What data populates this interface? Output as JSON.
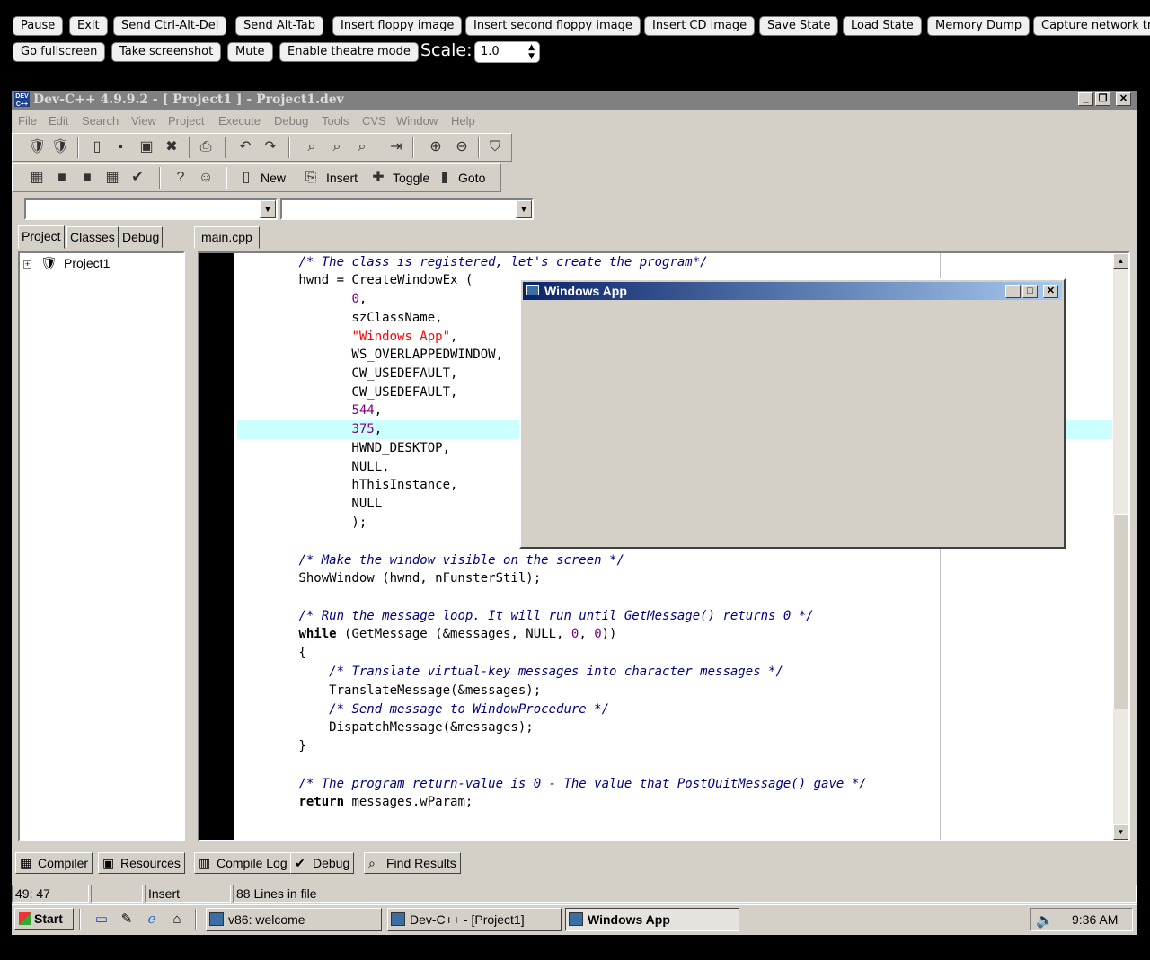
{
  "host_toolbar": {
    "buttons": [
      "Pause",
      "Exit",
      "Send Ctrl-Alt-Del",
      "Send Alt-Tab",
      "Insert floppy image",
      "Insert second floppy image",
      "Insert CD image",
      "Save State",
      "Load State",
      "Memory Dump",
      "Capture network traffic"
    ],
    "buttons_row2": [
      "Go fullscreen",
      "Take screenshot",
      "Mute",
      "Enable theatre mode"
    ],
    "scale_label": "Scale:",
    "scale_value": "1.0"
  },
  "ide": {
    "title": "Dev-C++ 4.9.9.2  -  [ Project1 ] - Project1.dev",
    "menu": [
      "File",
      "Edit",
      "Search",
      "View",
      "Project",
      "Execute",
      "Debug",
      "Tools",
      "CVS",
      "Window",
      "Help"
    ],
    "toolbar2": {
      "new_label": "New",
      "insert_label": "Insert",
      "toggle_label": "Toggle",
      "goto_label": "Goto"
    },
    "left_tabs": [
      "Project",
      "Classes",
      "Debug"
    ],
    "project_tree_root": "Project1",
    "file_tab": "main.cpp",
    "code_lines": [
      [
        {
          "t": "        "
        },
        {
          "t": "/* The class is registered, let's create the program*/",
          "c": "cm"
        }
      ],
      [
        {
          "t": "        hwnd = CreateWindowEx ("
        }
      ],
      [
        {
          "t": "               "
        },
        {
          "t": "0",
          "c": "nm"
        },
        {
          "t": ","
        }
      ],
      [
        {
          "t": "               szClassName,"
        }
      ],
      [
        {
          "t": "               "
        },
        {
          "t": "\"Windows App\"",
          "c": "st"
        },
        {
          "t": ","
        }
      ],
      [
        {
          "t": "               WS_OVERLAPPEDWINDOW,"
        }
      ],
      [
        {
          "t": "               CW_USEDEFAULT,"
        }
      ],
      [
        {
          "t": "               CW_USEDEFAULT,"
        }
      ],
      [
        {
          "t": "               "
        },
        {
          "t": "544",
          "c": "nm"
        },
        {
          "t": ","
        }
      ],
      [
        {
          "t": "               "
        },
        {
          "t": "375",
          "c": "nm"
        },
        {
          "t": ","
        }
      ],
      [
        {
          "t": "               HWND_DESKTOP,"
        }
      ],
      [
        {
          "t": "               NULL,"
        }
      ],
      [
        {
          "t": "               hThisInstance,"
        }
      ],
      [
        {
          "t": "               NULL"
        }
      ],
      [
        {
          "t": "               );"
        }
      ],
      [
        {
          "t": ""
        }
      ],
      [
        {
          "t": "        "
        },
        {
          "t": "/* Make the window visible on the screen */",
          "c": "cm"
        }
      ],
      [
        {
          "t": "        ShowWindow (hwnd, nFunsterStil);"
        }
      ],
      [
        {
          "t": ""
        }
      ],
      [
        {
          "t": "        "
        },
        {
          "t": "/* Run the message loop. It will run until GetMessage() returns 0 */",
          "c": "cm"
        }
      ],
      [
        {
          "t": "        "
        },
        {
          "t": "while",
          "c": "kw"
        },
        {
          "t": " (GetMessage (&messages, NULL, "
        },
        {
          "t": "0",
          "c": "nm"
        },
        {
          "t": ", "
        },
        {
          "t": "0",
          "c": "nm"
        },
        {
          "t": "))"
        }
      ],
      [
        {
          "t": "        {"
        }
      ],
      [
        {
          "t": "            "
        },
        {
          "t": "/* Translate virtual-key messages into character messages */",
          "c": "cm"
        }
      ],
      [
        {
          "t": "            TranslateMessage(&messages);"
        }
      ],
      [
        {
          "t": "            "
        },
        {
          "t": "/* Send message to WindowProcedure */",
          "c": "cm"
        }
      ],
      [
        {
          "t": "            DispatchMessage(&messages);"
        }
      ],
      [
        {
          "t": "        }"
        }
      ],
      [
        {
          "t": ""
        }
      ],
      [
        {
          "t": "        "
        },
        {
          "t": "/* The program return-value is 0 - The value that PostQuitMessage() gave */",
          "c": "cm"
        }
      ],
      [
        {
          "t": "        "
        },
        {
          "t": "return",
          "c": "kw"
        },
        {
          "t": " messages.wParam;"
        }
      ],
      [
        {
          "t": "}"
        }
      ]
    ],
    "bottom_tabs": [
      "Compiler",
      "Resources",
      "Compile Log",
      "Debug",
      "Find Results"
    ],
    "status": {
      "position": "49: 47",
      "mode": "Insert",
      "lines": "88 Lines in file"
    }
  },
  "app_window": {
    "title": "Windows App"
  },
  "taskbar": {
    "start_label": "Start",
    "tasks": [
      "v86: welcome",
      "Dev-C++ - [Project1]",
      "Windows App"
    ],
    "clock": "9:36 AM"
  },
  "icons": {
    "app": "devcpp-icon",
    "tree": "project-icon",
    "tray": "speaker-icon"
  }
}
